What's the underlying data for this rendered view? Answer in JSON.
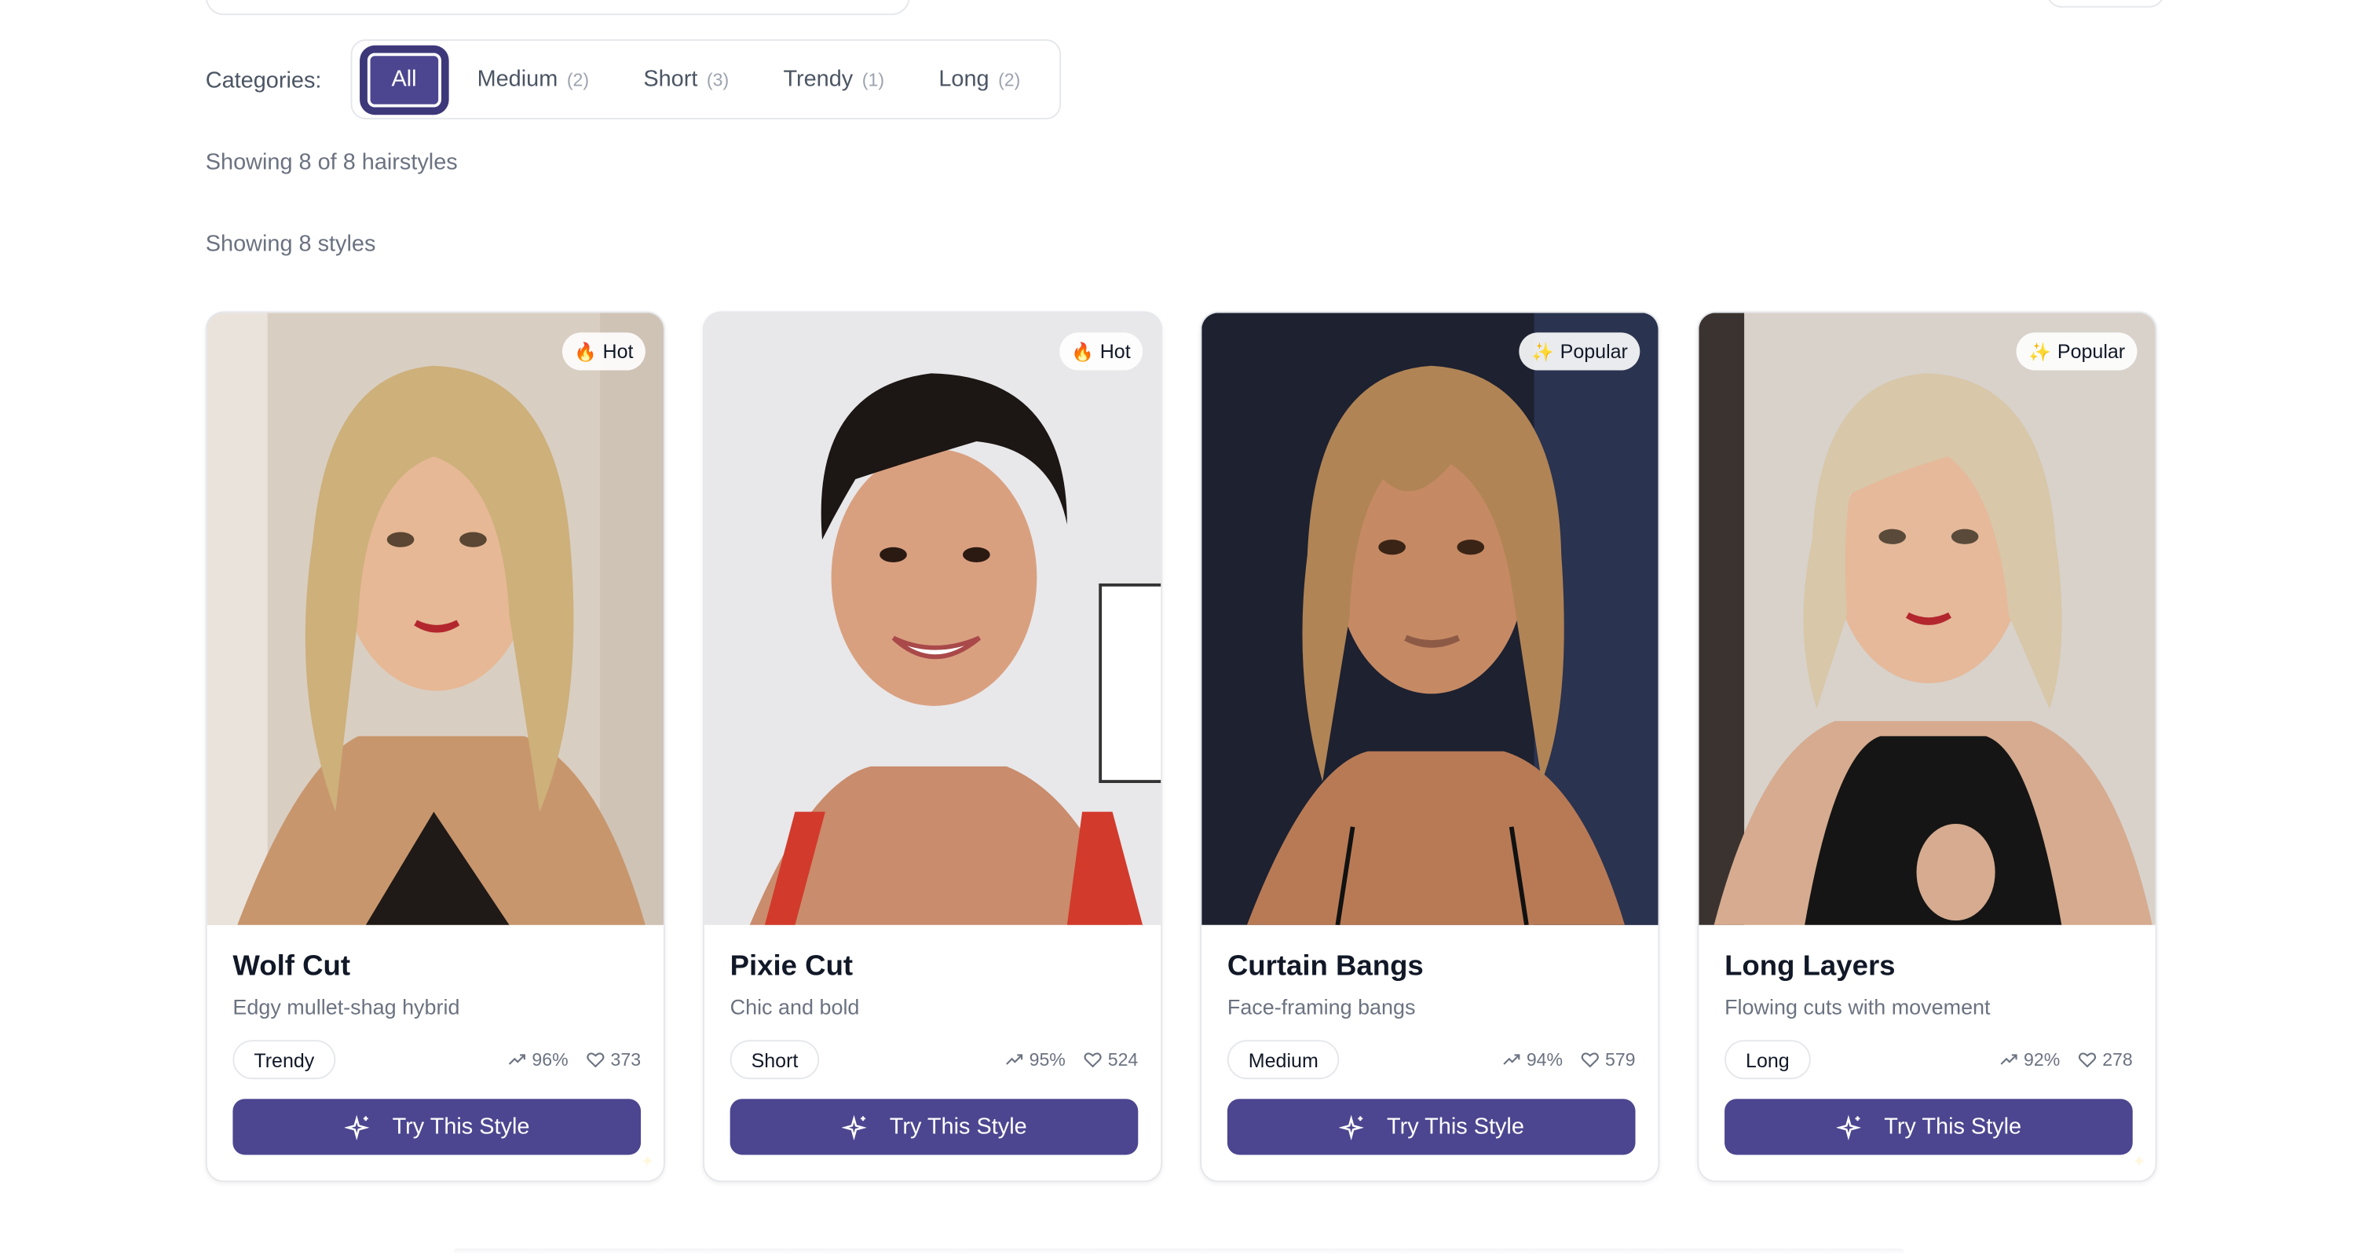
{
  "categories": {
    "label": "Categories:",
    "items": [
      {
        "label": "All",
        "count": ""
      },
      {
        "label": "Medium",
        "count": "(2)"
      },
      {
        "label": "Short",
        "count": "(3)"
      },
      {
        "label": "Trendy",
        "count": "(1)"
      },
      {
        "label": "Long",
        "count": "(2)"
      }
    ]
  },
  "summary": {
    "showing_hairstyles": "Showing 8 of 8 hairstyles",
    "showing_styles": "Showing 8 styles"
  },
  "cards": [
    {
      "title": "Wolf Cut",
      "subtitle": "Edgy mullet-shag hybrid",
      "tag": "Trendy",
      "trend": "96%",
      "likes": "373",
      "badge_icon": "🔥",
      "badge": "Hot",
      "button": "Try This Style"
    },
    {
      "title": "Pixie Cut",
      "subtitle": "Chic and bold",
      "tag": "Short",
      "trend": "95%",
      "likes": "524",
      "badge_icon": "🔥",
      "badge": "Hot",
      "button": "Try This Style"
    },
    {
      "title": "Curtain Bangs",
      "subtitle": "Face-framing bangs",
      "tag": "Medium",
      "trend": "94%",
      "likes": "579",
      "badge_icon": "✨",
      "badge": "Popular",
      "button": "Try This Style"
    },
    {
      "title": "Long Layers",
      "subtitle": "Flowing cuts with movement",
      "tag": "Long",
      "trend": "92%",
      "likes": "278",
      "badge_icon": "✨",
      "badge": "Popular",
      "button": "Try This Style"
    }
  ],
  "colors": {
    "accent": "#4c4690",
    "border": "#e5e7eb",
    "muted_text": "#6b7280"
  },
  "icons": {
    "trend": "trending-up-icon",
    "likes": "heart-icon",
    "button": "sparkles-icon"
  }
}
